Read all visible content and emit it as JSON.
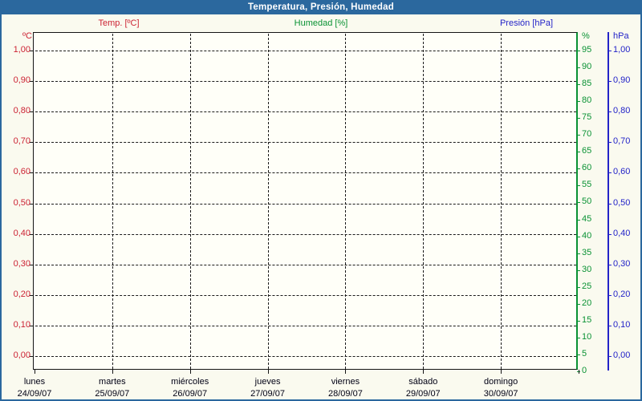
{
  "window": {
    "title": "Temperatura, Presión, Humedad",
    "title_bar_color": "#2b689e",
    "background_color": "#fafaef"
  },
  "legend": {
    "items": [
      {
        "label": "Temp. [ºC]",
        "color": "#cc2233"
      },
      {
        "label": "Humedad [%]",
        "color": "#0a9234"
      },
      {
        "label": "Presión [hPa]",
        "color": "#2323c8"
      }
    ]
  },
  "chart_data": {
    "type": "line",
    "title": "Temperatura, Presión, Humedad",
    "empty": true,
    "note": "empty plot grid - no data points drawn for any series",
    "grid": true,
    "series": [
      {
        "name": "Temp. [ºC]",
        "axis": "temperature",
        "color": "#cc2233",
        "values": []
      },
      {
        "name": "Humedad [%]",
        "axis": "humidity",
        "color": "#0a9234",
        "values": []
      },
      {
        "name": "Presión [hPa]",
        "axis": "pressure",
        "color": "#2323c8",
        "values": []
      }
    ],
    "axes": {
      "temperature": {
        "side": "left",
        "unit": "ºC",
        "color": "#cc2233",
        "min": 0.0,
        "max": 1.0,
        "step": 0.1,
        "tick_labels": [
          "1,00",
          "0,90",
          "0,80",
          "0,70",
          "0,60",
          "0,50",
          "0,40",
          "0,30",
          "0,20",
          "0,10",
          "0,00"
        ]
      },
      "humidity": {
        "side": "right-inner",
        "unit": "%",
        "color": "#0a9234",
        "min": 0,
        "max": 95,
        "step": 5,
        "tick_labels": [
          "95",
          "90",
          "85",
          "80",
          "75",
          "70",
          "65",
          "60",
          "55",
          "50",
          "45",
          "40",
          "35",
          "30",
          "25",
          "20",
          "15",
          "10",
          "5",
          "0"
        ]
      },
      "pressure": {
        "side": "right-outer",
        "unit": "hPa",
        "color": "#2323c8",
        "min": 0.0,
        "max": 1.0,
        "step": 0.1,
        "tick_labels": [
          "1,00",
          "0,90",
          "0,80",
          "0,70",
          "0,60",
          "0,50",
          "0,40",
          "0,30",
          "0,20",
          "0,10",
          "0,00"
        ]
      }
    },
    "x_axis": {
      "days": [
        {
          "name": "lunes",
          "date": "24/09/07"
        },
        {
          "name": "martes",
          "date": "25/09/07"
        },
        {
          "name": "miércoles",
          "date": "26/09/07"
        },
        {
          "name": "jueves",
          "date": "27/09/07"
        },
        {
          "name": "viernes",
          "date": "28/09/07"
        },
        {
          "name": "sábado",
          "date": "29/09/07"
        },
        {
          "name": "domingo",
          "date": "30/09/07"
        }
      ]
    }
  }
}
